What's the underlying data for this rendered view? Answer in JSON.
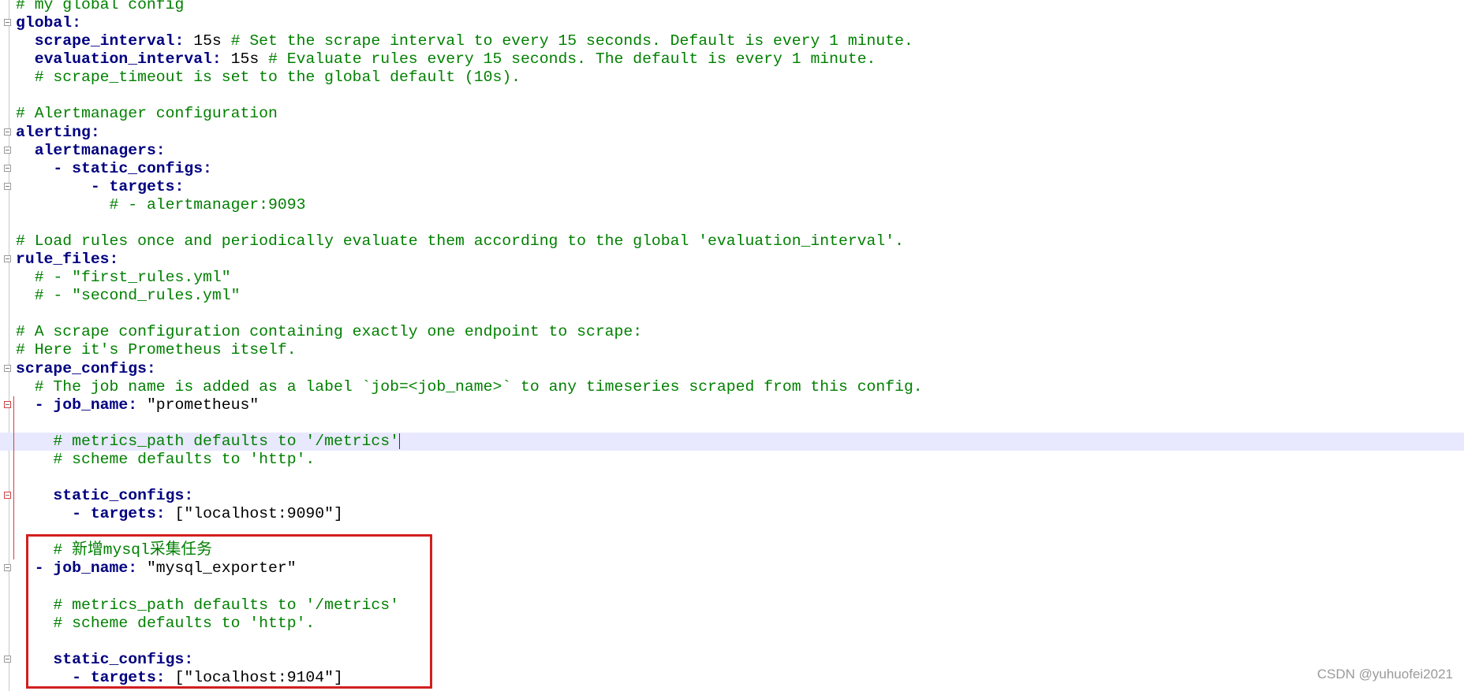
{
  "editor": {
    "current_line": 24,
    "fold_lines": [
      1,
      7,
      8,
      9,
      10,
      14,
      20,
      22,
      27,
      31,
      36
    ],
    "modified_fold_lines": [
      22,
      27
    ],
    "changed_lines": [
      22,
      23,
      24,
      25,
      26,
      27,
      28,
      29,
      30
    ],
    "colors": {
      "key": "#000080",
      "comment": "#008000",
      "value": "#000000",
      "annotation_box": "#d21f1f",
      "current_line_bg": "#e8e8ff"
    },
    "lines": [
      "# my global config",
      "global:",
      "  scrape_interval: 15s # Set the scrape interval to every 15 seconds. Default is every 1 minute.",
      "  evaluation_interval: 15s # Evaluate rules every 15 seconds. The default is every 1 minute.",
      "  # scrape_timeout is set to the global default (10s).",
      "",
      "# Alertmanager configuration",
      "alerting:",
      "  alertmanagers:",
      "    - static_configs:",
      "        - targets:",
      "          # - alertmanager:9093",
      "",
      "# Load rules once and periodically evaluate them according to the global 'evaluation_interval'.",
      "rule_files:",
      "  # - \"first_rules.yml\"",
      "  # - \"second_rules.yml\"",
      "",
      "# A scrape configuration containing exactly one endpoint to scrape:",
      "# Here it's Prometheus itself.",
      "scrape_configs:",
      "  # The job name is added as a label `job=<job_name>` to any timeseries scraped from this config.",
      "  - job_name: \"prometheus\"",
      "",
      "    # metrics_path defaults to '/metrics'",
      "    # scheme defaults to 'http'.",
      "",
      "    static_configs:",
      "      - targets: [\"localhost:9090\"]",
      "",
      "    # 新增mysql采集任务",
      "  - job_name: \"mysql_exporter\"",
      "",
      "    # metrics_path defaults to '/metrics'",
      "    # scheme defaults to 'http'.",
      "",
      "    static_configs:",
      "      - targets: [\"localhost:9104\"]"
    ]
  },
  "watermark": "CSDN @yuhuofei2021"
}
